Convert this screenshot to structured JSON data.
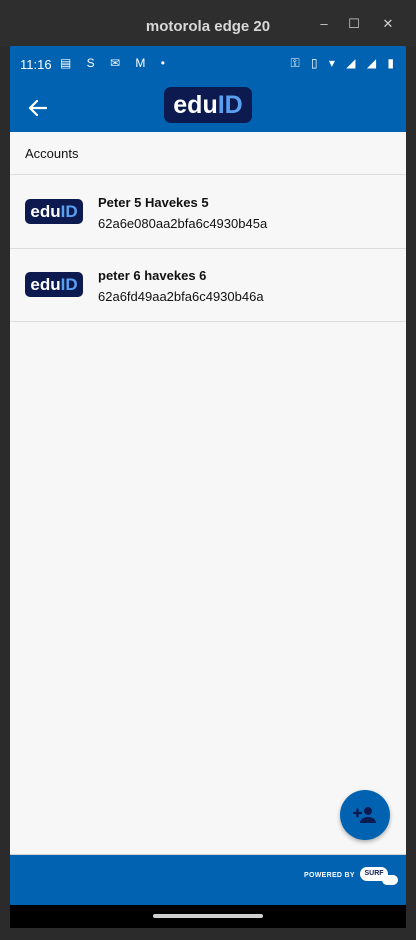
{
  "window": {
    "title": "motorola edge 20",
    "minimize": "–",
    "maximize": "☐",
    "close": "✕"
  },
  "status_bar": {
    "time": "11:16",
    "left_icons": "▤ S ✉ M •",
    "right_icons": "⚿ ▯ ▾ ◢ ◢ ▮"
  },
  "app_bar": {
    "logo_prefix": "edu",
    "logo_suffix": "ID"
  },
  "section": {
    "title": "Accounts"
  },
  "accounts": [
    {
      "logo_prefix": "edu",
      "logo_suffix": "ID",
      "name": "Peter 5 Havekes 5",
      "uid": "62a6e080aa2bfa6c4930b45a"
    },
    {
      "logo_prefix": "edu",
      "logo_suffix": "ID",
      "name": "peter 6 havekes 6",
      "uid": "62a6fd49aa2bfa6c4930b46a"
    }
  ],
  "footer": {
    "powered_by": "POWERED BY",
    "brand": "SURF"
  },
  "colors": {
    "primary": "#0062b0",
    "logo_bg": "#0d1a4f",
    "logo_accent": "#5aa0f0"
  },
  "icons": {
    "back": "arrow-left-icon",
    "fab": "add-person-icon"
  }
}
